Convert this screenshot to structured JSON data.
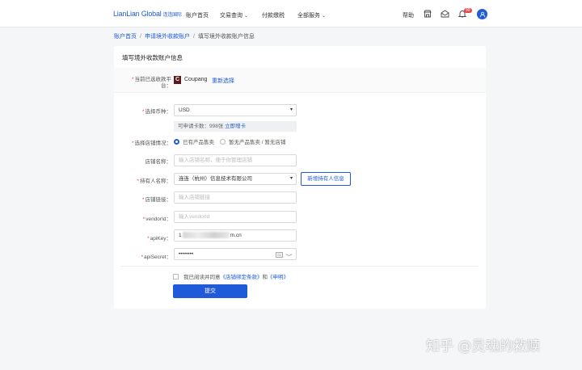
{
  "header": {
    "logo_text": "LianLian Global",
    "logo_cn": "连连国际",
    "nav": [
      {
        "label": "账户首页"
      },
      {
        "label": "交易查询",
        "has_dropdown": true
      },
      {
        "label": "付款缴税"
      },
      {
        "label": "全部服务",
        "has_dropdown": true
      }
    ],
    "help_label": "帮助",
    "notification_count": "99",
    "icons": [
      "shop-icon",
      "mail-icon",
      "bell-icon",
      "user-avatar-icon"
    ]
  },
  "breadcrumb": {
    "items": [
      "账户首页",
      "申请境外收款账户",
      "填写境外收款账户信息"
    ]
  },
  "form": {
    "title": "填写境外收款账户信息",
    "platform_label": "当前已选收款平台：",
    "platform_name": "Coupang",
    "platform_logo": "C",
    "reselect_label": "重新选择",
    "currency_label": "选择币种：",
    "currency_value": "USD",
    "quota_text": "可申请卡数：998张",
    "quota_link": "立即增卡",
    "shop_status_label": "选择店铺情况：",
    "shop_status_options": [
      "已有产品售卖",
      "暂无产品售卖 / 暂无店铺"
    ],
    "shop_status_selected": "已有产品售卖",
    "shop_name_label": "店铺名称：",
    "shop_name_placeholder": "输入店铺名称，便于你管理店铺",
    "holder_label": "持有人名称：",
    "holder_value": "连连（杭州）信息技术有限公司",
    "add_holder_label": "新增持有人信息",
    "shop_link_label": "店铺链接：",
    "shop_link_placeholder": "输入店铺链接",
    "vendor_label": "vendorId：",
    "vendor_placeholder": "输入vendorId",
    "apikey_label": "apiKey：",
    "apikey_prefix": "1",
    "apikey_suffix": "m.cn",
    "apisecret_label": "apiSecret：",
    "apisecret_value": "••••••••",
    "agree_prefix": "我已阅读并同意",
    "agree_terms": "《店铺绑定条款》",
    "agree_and": "和",
    "agree_statement": "《申明》",
    "submit_label": "提交"
  },
  "watermark": "知乎 @灵魂的救赎",
  "colors": {
    "accent": "#1f5bd8",
    "required": "#e64545",
    "background": "#f5f6f8"
  }
}
